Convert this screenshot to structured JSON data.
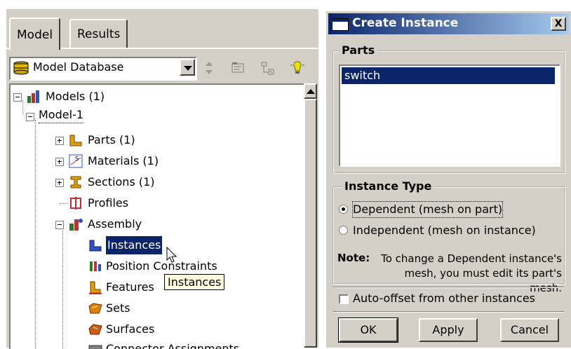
{
  "left_panel": {
    "tabs": [
      {
        "label": "Model",
        "active": true
      },
      {
        "label": "Results",
        "active": false
      }
    ],
    "context_combo": {
      "value": "Model Database",
      "icon": "database-icon"
    },
    "toolbar_icons": [
      "up-down-arrows-icon",
      "filter-icon",
      "tree-expand-icon",
      "lightbulb-icon"
    ],
    "tree": {
      "root": {
        "label": "Models (1)",
        "icon": "models-icon"
      },
      "model": {
        "label": "Model-1"
      },
      "nodes": [
        {
          "label": "Parts (1)",
          "icon": "parts-icon"
        },
        {
          "label": "Materials (1)",
          "icon": "materials-icon"
        },
        {
          "label": "Sections (1)",
          "icon": "sections-icon"
        },
        {
          "label": "Profiles",
          "icon": "profiles-icon"
        },
        {
          "label": "Assembly",
          "icon": "assembly-icon"
        }
      ],
      "assembly_children": [
        {
          "label": "Instances",
          "icon": "instances-icon",
          "selected": true
        },
        {
          "label": "Position Constraints",
          "icon": "position-constraints-icon"
        },
        {
          "label": "Features",
          "icon": "features-icon"
        },
        {
          "label": "Sets",
          "icon": "sets-icon"
        },
        {
          "label": "Surfaces",
          "icon": "surfaces-icon"
        },
        {
          "label": "Connector Assignments",
          "icon": "connector-icon"
        }
      ]
    },
    "tooltip": "Instances"
  },
  "dialog": {
    "title": "Create Instance",
    "close_label": "X",
    "parts_group": {
      "title": "Parts",
      "items": [
        "switch"
      ],
      "selected": "switch"
    },
    "instance_type": {
      "title": "Instance Type",
      "options": [
        {
          "label": "Dependent (mesh on part)",
          "checked": true
        },
        {
          "label": "Independent (mesh on instance)",
          "checked": false
        }
      ],
      "note_label": "Note:",
      "note_line1": "To change a Dependent instance's",
      "note_line2": "mesh, you must edit its part's mesh."
    },
    "auto_offset": {
      "label": "Auto-offset from other instances",
      "checked": false
    },
    "buttons": {
      "ok": "OK",
      "apply": "Apply",
      "cancel": "Cancel"
    }
  },
  "colors": {
    "selection": "#0a246a",
    "dialog_bg": "#d4d0c8",
    "title_gradient_end": "#a6caf0"
  }
}
